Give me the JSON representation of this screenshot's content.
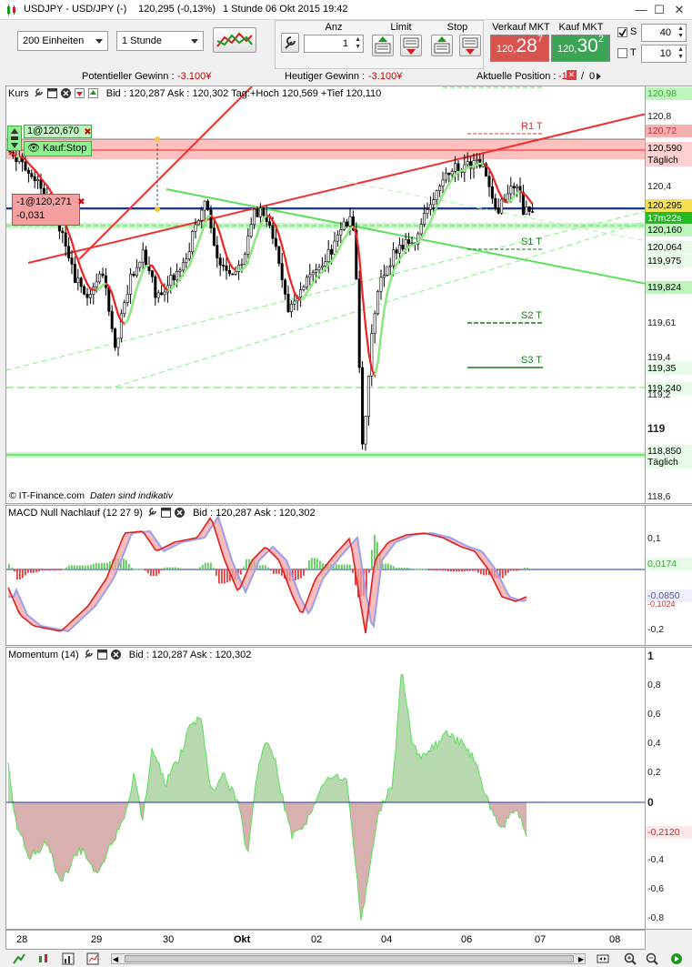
{
  "title": {
    "symbol": "USDJPY - USD/JPY (-)",
    "price": "120,295 (-0,13%)",
    "interval": "1 Stunde",
    "datetime": "06 Okt 2015 19:42"
  },
  "toolbar": {
    "units": "200 Einheiten",
    "timeframe": "1 Stunde",
    "anz_label": "Anz",
    "anz_value": "1",
    "limit_label": "Limit",
    "stop_label": "Stop",
    "sell_label": "Verkauf MKT",
    "sell_small": "120,",
    "sell_big": "28",
    "sell_sup": "7",
    "buy_label": "Kauf MKT",
    "buy_small": "120,",
    "buy_big": "30",
    "buy_sup": "2",
    "s_label": "S",
    "s_value": "40",
    "t_label": "T",
    "t_value": "10"
  },
  "infobar": {
    "pot_label": "Potentieller Gewinn :",
    "pot_value": "-3.100¥",
    "today_label": "Heutiger Gewinn :",
    "today_value": "-3.100¥",
    "pos_label": "Aktuelle Position :",
    "pos_value": "-1",
    "pos_sep": "/",
    "pos_value2": "0"
  },
  "price_panel": {
    "title": "Kurs",
    "quote": "Bid : 120,287 Ask : 120,302 Tag:+Hoch 120,569 +Tief 120,110",
    "order1": "1@120,670",
    "order1_tag": "Kauf:Stop",
    "order2": "-1@120,271",
    "order2_pl": "-0,031",
    "pivots": {
      "r1": "R1 T",
      "s1": "S1 T",
      "s2": "S2 T",
      "s3": "S3 T"
    },
    "footnote_brand": "© IT-Finance.com",
    "footnote_note": "Daten sind indikativ",
    "yticks": [
      "120,98",
      "120,8",
      "120,72",
      "120,590",
      "Täglich",
      "120,4",
      "120,295",
      "17m22s",
      "120,160",
      "120,064",
      "119,975",
      "119,824",
      "119,61",
      "119,4",
      "119,35",
      "119,240",
      "119,2",
      "119",
      "118,850",
      "Täglich",
      "118,6"
    ],
    "big_tick": "119"
  },
  "macd_panel": {
    "title": "MACD Null Nachlauf (12 27 9)",
    "quote": "Bid : 120,287 Ask : 120,302",
    "yticks": [
      "0,1",
      "0,0174",
      "-0,0850",
      "-0,1024",
      "-0,2"
    ]
  },
  "momentum_panel": {
    "title": "Momentum (14)",
    "quote": "Bid : 120,287 Ask : 120,302",
    "yticks": [
      "1",
      "0,8",
      "0,6",
      "0,4",
      "0,2",
      "0",
      "-0,2120",
      "-0,4",
      "-0,6",
      "-0,8"
    ]
  },
  "xaxis": [
    "28",
    "29",
    "30",
    "Okt",
    "02",
    "04",
    "06",
    "07",
    "08"
  ],
  "colors": {
    "sell": "#d9534f",
    "buy": "#3aa655",
    "bull": "#7ef37e",
    "bear": "#ee2222"
  }
}
